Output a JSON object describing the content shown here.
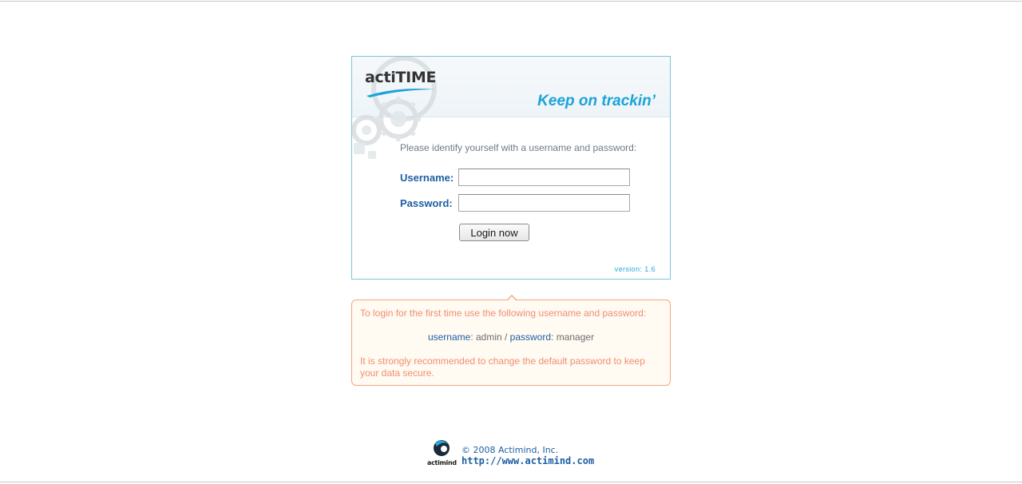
{
  "login": {
    "logo_text": "actiTIME",
    "tagline": "Keep on trackin’",
    "prompt": "Please identify yourself with a username and password:",
    "username_label": "Username:",
    "password_label": "Password:",
    "username_value": "",
    "password_value": "",
    "login_button": "Login now",
    "version": "version: 1.6"
  },
  "info": {
    "line1": "To login for the first time use the following username and password:",
    "username_key": "username",
    "username_value": ": admin / ",
    "password_key": "password",
    "password_value": ": manager",
    "warning": "It is strongly recommended to change the default password to keep your data secure."
  },
  "footer": {
    "logo_text": "actimind",
    "copyright": "© 2008 Actimind, Inc.",
    "url": "http://www.actimind.com"
  },
  "colors": {
    "brand_blue": "#1aa3d8",
    "label_blue": "#1d5fa3",
    "info_orange": "#f08e70"
  }
}
